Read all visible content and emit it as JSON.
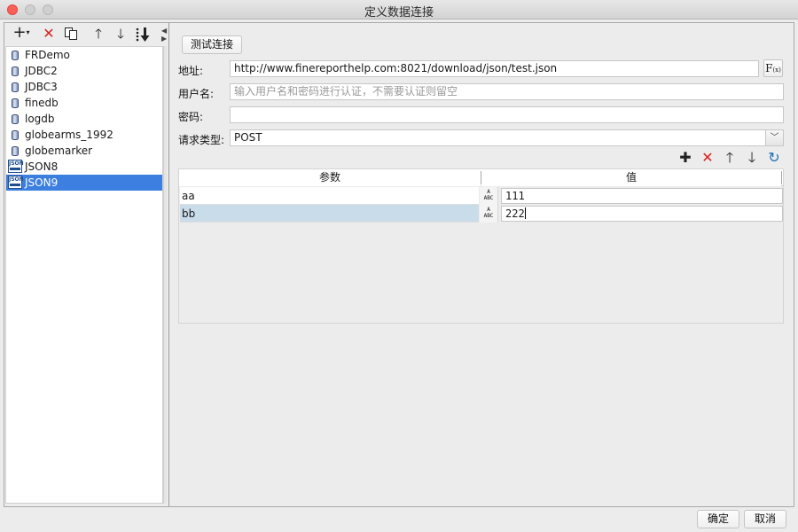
{
  "window": {
    "title": "定义数据连接"
  },
  "left_toolbar": {
    "icons": [
      "add-dropdown-icon",
      "delete-icon",
      "copy-icon",
      "move-up-icon",
      "move-down-icon",
      "sort-icon"
    ]
  },
  "connections": [
    {
      "label": "FRDemo",
      "icon": "database-icon",
      "selected": false
    },
    {
      "label": "JDBC2",
      "icon": "database-icon",
      "selected": false
    },
    {
      "label": "JDBC3",
      "icon": "database-icon",
      "selected": false
    },
    {
      "label": "finedb",
      "icon": "database-icon",
      "selected": false
    },
    {
      "label": "logdb",
      "icon": "database-icon",
      "selected": false
    },
    {
      "label": "globearms_1992",
      "icon": "database-icon",
      "selected": false
    },
    {
      "label": "globemarker",
      "icon": "database-icon",
      "selected": false
    },
    {
      "label": "JSON8",
      "icon": "json-icon",
      "selected": false
    },
    {
      "label": "JSON9",
      "icon": "json-icon",
      "selected": true
    }
  ],
  "json_icon_text": "JSON",
  "form": {
    "test_button": "测试连接",
    "address_label": "地址:",
    "address_value": "http://www.finereporthelp.com:8021/download/json/test.json",
    "formula_button": "F",
    "formula_sub": "(x)",
    "username_label": "用户名:",
    "username_placeholder": "输入用户名和密码进行认证，不需要认证则留空",
    "password_label": "密码:",
    "password_value": "",
    "request_type_label": "请求类型:",
    "request_type_value": "POST"
  },
  "param_toolbar": {
    "icons": [
      "add-icon",
      "delete-icon",
      "move-up-icon",
      "move-down-icon",
      "refresh-icon"
    ]
  },
  "params_table": {
    "columns": [
      "参数",
      "值"
    ],
    "type_icon_text": [
      "A",
      "ABC"
    ],
    "rows": [
      {
        "key": "aa",
        "value": "111",
        "selected": false
      },
      {
        "key": "bb",
        "value": "222",
        "selected": true
      }
    ]
  },
  "footer": {
    "ok": "确定",
    "cancel": "取消"
  },
  "colors": {
    "selection": "#3d7fe0",
    "row_selection": "#c9dcea",
    "delete_red": "#d9231b",
    "refresh_blue": "#1f6fb5"
  }
}
